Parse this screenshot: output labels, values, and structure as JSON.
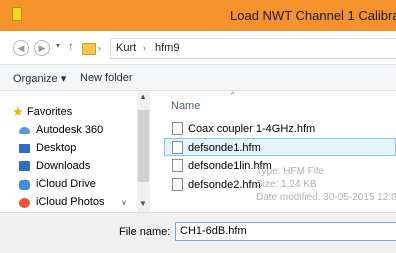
{
  "window": {
    "title": "Load NWT Channel 1 Calibrati"
  },
  "address": {
    "path": [
      "Kurt",
      "hfm9"
    ]
  },
  "toolbar": {
    "organize_label": "Organize ▾",
    "new_folder_label": "New folder"
  },
  "sidebar": {
    "items": [
      {
        "label": "Favorites",
        "icon": "star-icon"
      },
      {
        "label": "Autodesk 360",
        "icon": "cloud-icon"
      },
      {
        "label": "Desktop",
        "icon": "desktop-icon"
      },
      {
        "label": "Downloads",
        "icon": "downloads-icon"
      },
      {
        "label": "iCloud Drive",
        "icon": "icloud-drive-icon"
      },
      {
        "label": "iCloud Photos",
        "icon": "icloud-photos-icon"
      }
    ]
  },
  "filelist": {
    "column_name": "Name",
    "files": [
      {
        "name": "Coax coupler 1-4GHz.hfm"
      },
      {
        "name": "defsonde1.hfm",
        "selected": true
      },
      {
        "name": "defsonde1lin.hfm"
      },
      {
        "name": "defsonde2.hfm"
      }
    ],
    "tooltip": {
      "type": "Type: HFM File",
      "size": "Size: 1,24 KB",
      "modified": "Date modified: 30-05-2015 12:0"
    }
  },
  "footer": {
    "filename_label": "File name:",
    "filename_value": "CH1-6dB.hfm"
  },
  "colors": {
    "titlebar": "#f5922b",
    "selection": "#e5f3fb",
    "selection_border": "#84c7ea"
  }
}
